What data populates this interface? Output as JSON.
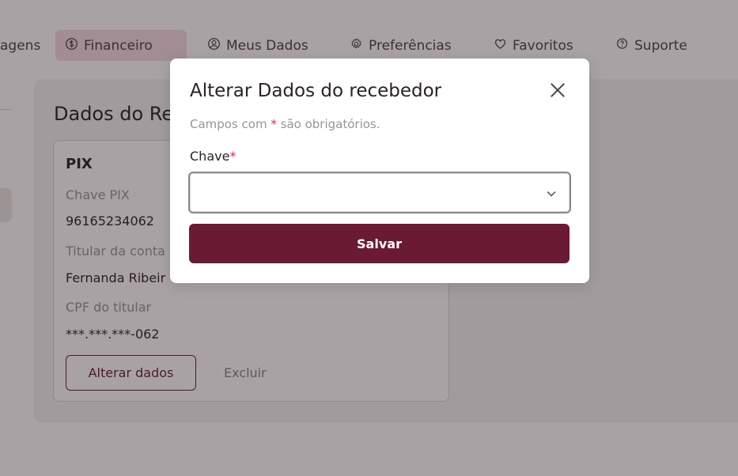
{
  "nav": {
    "items": [
      {
        "label": "agens",
        "icon": "envelope-icon"
      },
      {
        "label": "Financeiro",
        "icon": "dollar-circle-icon",
        "active": true
      },
      {
        "label": "Meus Dados",
        "icon": "user-circle-icon"
      },
      {
        "label": "Preferências",
        "icon": "gear-icon"
      },
      {
        "label": "Favoritos",
        "icon": "heart-icon"
      },
      {
        "label": "Suporte",
        "icon": "question-circle-icon"
      }
    ]
  },
  "page": {
    "section_title": "Dados do Re",
    "pix_card": {
      "title": "PIX",
      "fields": [
        {
          "label": "Chave PIX",
          "value": "96165234062"
        },
        {
          "label": "Titular da conta",
          "value": "Fernanda Ribeir"
        },
        {
          "label": "CPF do titular",
          "value": "***.***.***-062"
        }
      ],
      "alter_label": "Alterar dados",
      "delete_label": "Excluir"
    }
  },
  "modal": {
    "title": "Alterar Dados do recebedor",
    "note_prefix": "Campos com ",
    "required_mark": "*",
    "note_suffix": " são obrigatórios.",
    "field_label": "Chave",
    "select_value": "",
    "save_label": "Salvar"
  },
  "colors": {
    "brand": "#6b1a33",
    "required": "#e0284a",
    "active_tab_bg": "#f2dde3"
  }
}
